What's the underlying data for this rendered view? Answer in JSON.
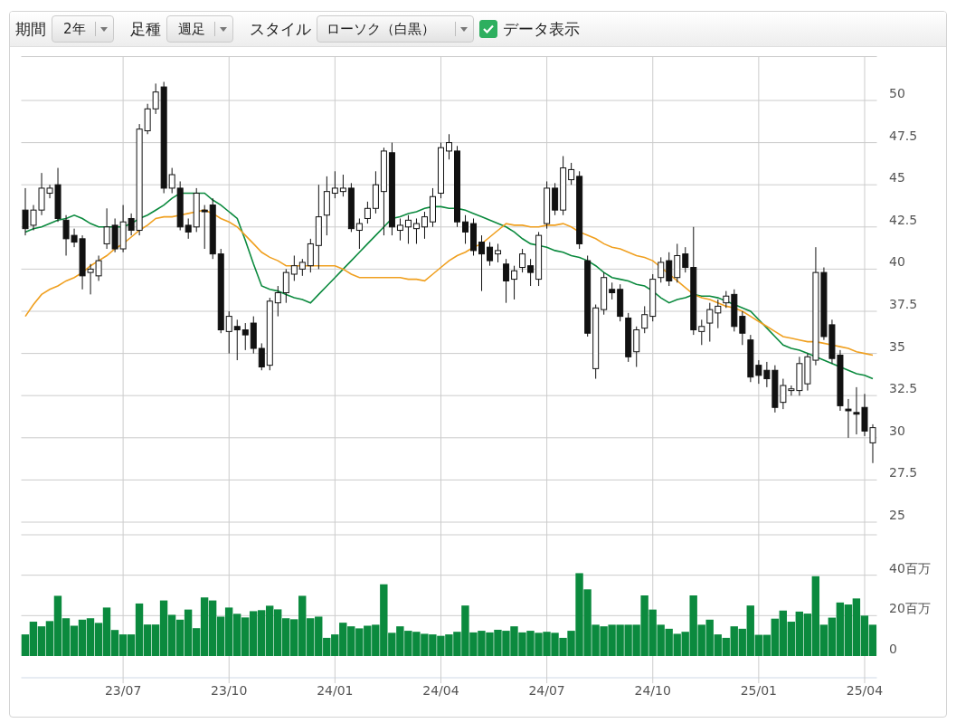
{
  "toolbar": {
    "period": {
      "label": "期間",
      "value": "2年"
    },
    "bar_type": {
      "label": "足種",
      "value": "週足"
    },
    "style": {
      "label": "スタイル",
      "value": "ローソク（白黒）"
    },
    "show_data": {
      "label": "データ表示",
      "checked": true
    }
  },
  "price_chart": {
    "chart_data": {
      "type": "candlestick",
      "grid": true,
      "ylim": [
        25,
        52.6
      ],
      "yticks": [
        25,
        27.5,
        30,
        32.5,
        35,
        37.5,
        40,
        42.5,
        45,
        47.5,
        50
      ],
      "categories": [
        null,
        null,
        null,
        null,
        null,
        null,
        null,
        null,
        null,
        null,
        null,
        null,
        null,
        null,
        null,
        null,
        null,
        null,
        null,
        null,
        null,
        null,
        null,
        null,
        null,
        null,
        null,
        null,
        null,
        null,
        null,
        null,
        null,
        null,
        null,
        null,
        null,
        null,
        null,
        null,
        null,
        null,
        null,
        null,
        null,
        null,
        null,
        null,
        null,
        null,
        null,
        null,
        null,
        null,
        null,
        null,
        null,
        null,
        null,
        null,
        null,
        null,
        null,
        null,
        null,
        null,
        null,
        null,
        null,
        null,
        null,
        null,
        null,
        null,
        null,
        null,
        null,
        null,
        null,
        null,
        null,
        null,
        null,
        null,
        null,
        null,
        null,
        null,
        null,
        null,
        null,
        null,
        null,
        null,
        null,
        null,
        null,
        null,
        null,
        null,
        null,
        null,
        null,
        null,
        null
      ],
      "ohlc": [
        [
          43.5,
          44.8,
          42.0,
          42.4
        ],
        [
          42.6,
          43.8,
          42.3,
          43.5
        ],
        [
          43.5,
          45.7,
          43.2,
          44.8
        ],
        [
          44.5,
          45.0,
          44.2,
          44.8
        ],
        [
          45.0,
          46.0,
          42.8,
          43.0
        ],
        [
          42.9,
          43.2,
          40.8,
          41.8
        ],
        [
          42.0,
          42.4,
          41.3,
          41.6
        ],
        [
          41.8,
          42.0,
          38.8,
          39.6
        ],
        [
          39.8,
          40.3,
          38.5,
          40.0
        ],
        [
          39.6,
          40.8,
          39.3,
          40.5
        ],
        [
          41.5,
          43.6,
          41.2,
          42.5
        ],
        [
          42.6,
          43.0,
          41.0,
          41.2
        ],
        [
          41.2,
          43.8,
          41.0,
          42.8
        ],
        [
          43.0,
          43.3,
          42.0,
          42.3
        ],
        [
          42.3,
          48.6,
          42.0,
          48.3
        ],
        [
          48.2,
          49.8,
          48.0,
          49.5
        ],
        [
          49.5,
          51.0,
          49.2,
          50.5
        ],
        [
          50.8,
          51.1,
          44.5,
          44.8
        ],
        [
          44.8,
          46.0,
          44.5,
          45.6
        ],
        [
          44.8,
          45.2,
          42.3,
          42.5
        ],
        [
          42.6,
          43.0,
          41.8,
          42.2
        ],
        [
          42.5,
          44.8,
          42.2,
          44.5
        ],
        [
          43.5,
          43.8,
          41.2,
          43.4
        ],
        [
          43.8,
          44.2,
          40.6,
          40.9
        ],
        [
          40.9,
          41.2,
          36.2,
          36.4
        ],
        [
          36.3,
          37.5,
          35.0,
          37.2
        ],
        [
          36.6,
          37.0,
          34.6,
          36.4
        ],
        [
          36.4,
          36.8,
          35.2,
          36.1
        ],
        [
          36.8,
          37.2,
          35.0,
          35.3
        ],
        [
          35.3,
          35.6,
          34.0,
          34.2
        ],
        [
          34.3,
          38.3,
          34.0,
          38.1
        ],
        [
          38.0,
          39.0,
          37.2,
          38.6
        ],
        [
          38.6,
          40.0,
          38.0,
          39.8
        ],
        [
          39.7,
          40.8,
          39.3,
          40.2
        ],
        [
          40.0,
          40.6,
          39.6,
          40.4
        ],
        [
          40.2,
          41.8,
          39.8,
          41.5
        ],
        [
          41.4,
          45.0,
          40.0,
          43.1
        ],
        [
          43.2,
          45.5,
          42.0,
          44.6
        ],
        [
          44.5,
          45.8,
          44.2,
          44.8
        ],
        [
          44.6,
          45.6,
          44.3,
          44.8
        ],
        [
          44.8,
          45.1,
          42.2,
          42.4
        ],
        [
          42.3,
          43.0,
          41.2,
          42.7
        ],
        [
          43.0,
          44.0,
          42.7,
          43.6
        ],
        [
          43.6,
          45.8,
          43.3,
          45.0
        ],
        [
          44.6,
          47.2,
          42.0,
          47.0
        ],
        [
          46.9,
          47.5,
          42.0,
          42.5
        ],
        [
          42.3,
          43.0,
          41.7,
          42.6
        ],
        [
          42.5,
          43.2,
          41.5,
          42.9
        ],
        [
          42.4,
          43.0,
          41.5,
          42.7
        ],
        [
          42.5,
          43.4,
          41.8,
          43.1
        ],
        [
          42.8,
          44.8,
          42.5,
          44.3
        ],
        [
          44.5,
          47.5,
          44.2,
          47.2
        ],
        [
          47.0,
          48.0,
          46.5,
          47.5
        ],
        [
          47.0,
          47.3,
          42.5,
          42.8
        ],
        [
          42.8,
          43.2,
          41.5,
          42.2
        ],
        [
          42.7,
          43.0,
          40.8,
          41.1
        ],
        [
          41.6,
          42.0,
          38.7,
          40.9
        ],
        [
          41.3,
          41.6,
          40.2,
          40.5
        ],
        [
          40.9,
          41.5,
          40.4,
          41.1
        ],
        [
          40.3,
          40.6,
          38.0,
          39.3
        ],
        [
          39.4,
          40.2,
          38.2,
          39.9
        ],
        [
          40.1,
          41.2,
          39.8,
          40.9
        ],
        [
          40.2,
          40.6,
          39.0,
          39.8
        ],
        [
          39.4,
          42.2,
          39.0,
          42.0
        ],
        [
          42.7,
          45.2,
          42.4,
          44.8
        ],
        [
          44.8,
          45.1,
          43.2,
          43.5
        ],
        [
          43.5,
          46.7,
          43.2,
          46.0
        ],
        [
          45.3,
          46.3,
          45.0,
          45.9
        ],
        [
          45.5,
          45.8,
          41.2,
          41.5
        ],
        [
          40.5,
          40.8,
          36.0,
          36.2
        ],
        [
          34.1,
          37.9,
          33.5,
          37.7
        ],
        [
          37.6,
          39.8,
          37.3,
          39.5
        ],
        [
          38.8,
          39.2,
          38.2,
          38.6
        ],
        [
          38.8,
          39.1,
          36.9,
          37.2
        ],
        [
          37.1,
          37.4,
          34.5,
          34.8
        ],
        [
          35.1,
          36.6,
          34.2,
          36.4
        ],
        [
          36.5,
          37.8,
          36.2,
          37.3
        ],
        [
          37.2,
          39.7,
          36.9,
          39.4
        ],
        [
          39.5,
          40.7,
          39.2,
          40.4
        ],
        [
          40.5,
          41.0,
          39.0,
          39.3
        ],
        [
          39.5,
          41.5,
          39.2,
          40.8
        ],
        [
          40.9,
          41.3,
          39.8,
          40.1
        ],
        [
          40.1,
          42.5,
          36.1,
          36.4
        ],
        [
          36.3,
          37.0,
          35.5,
          36.6
        ],
        [
          36.8,
          38.0,
          35.7,
          37.6
        ],
        [
          37.4,
          38.2,
          36.5,
          37.8
        ],
        [
          38.0,
          38.7,
          37.7,
          38.4
        ],
        [
          38.5,
          38.8,
          36.3,
          36.6
        ],
        [
          37.2,
          37.5,
          35.5,
          36.2
        ],
        [
          35.8,
          36.1,
          33.3,
          33.6
        ],
        [
          34.3,
          34.6,
          33.2,
          33.7
        ],
        [
          34.0,
          34.5,
          33.0,
          33.5
        ],
        [
          34.0,
          34.3,
          31.5,
          31.8
        ],
        [
          32.1,
          33.5,
          31.7,
          33.1
        ],
        [
          32.8,
          33.1,
          32.5,
          32.9
        ],
        [
          32.8,
          34.8,
          32.5,
          34.4
        ],
        [
          33.2,
          35.0,
          32.8,
          34.8
        ],
        [
          34.6,
          41.3,
          34.3,
          39.8
        ],
        [
          39.8,
          40.1,
          35.8,
          36.0
        ],
        [
          36.7,
          37.0,
          34.4,
          34.7
        ],
        [
          34.9,
          35.2,
          31.6,
          31.9
        ],
        [
          31.7,
          32.3,
          30.0,
          31.6
        ],
        [
          31.5,
          33.0,
          30.2,
          31.4
        ],
        [
          31.8,
          32.6,
          30.1,
          30.4
        ],
        [
          29.7,
          30.8,
          28.5,
          30.6
        ]
      ],
      "series": [
        {
          "type": "line",
          "color": "#0b8a3e",
          "values": [
            42.2,
            42.4,
            42.5,
            42.7,
            42.9,
            43.0,
            43.2,
            43.0,
            42.7,
            42.5,
            42.5,
            42.5,
            42.5,
            42.7,
            43.0,
            43.2,
            43.5,
            43.8,
            44.2,
            44.5,
            44.5,
            44.5,
            44.5,
            44.1,
            43.8,
            43.4,
            43.0,
            41.7,
            40.3,
            39.0,
            38.8,
            38.7,
            38.5,
            38.3,
            38.2,
            38.0,
            38.5,
            39.0,
            39.5,
            40.0,
            40.5,
            41.0,
            41.5,
            42.0,
            42.5,
            43.0,
            43.1,
            43.3,
            43.4,
            43.6,
            43.7,
            43.7,
            43.6,
            43.6,
            43.5,
            43.3,
            43.1,
            42.9,
            42.7,
            42.5,
            42.2,
            41.8,
            41.5,
            41.4,
            41.3,
            41.1,
            41.0,
            40.8,
            40.7,
            40.5,
            40.2,
            39.8,
            39.5,
            39.4,
            39.3,
            39.1,
            39.0,
            38.7,
            38.3,
            38.0,
            38.2,
            38.3,
            38.5,
            38.4,
            38.4,
            38.3,
            38.1,
            37.9,
            37.7,
            37.5,
            37.0,
            36.5,
            36.0,
            35.5,
            35.3,
            35.2,
            35.0,
            34.8,
            34.6,
            34.4,
            34.2,
            34.0,
            33.8,
            33.7,
            33.5
          ]
        },
        {
          "type": "line",
          "color": "#f0a020",
          "values": [
            37.2,
            37.9,
            38.5,
            38.8,
            39.0,
            39.3,
            39.5,
            39.8,
            40.2,
            40.5,
            40.8,
            41.2,
            41.5,
            41.9,
            42.3,
            42.6,
            43.0,
            43.1,
            43.1,
            43.2,
            43.3,
            43.4,
            43.5,
            43.3,
            43.0,
            42.8,
            42.5,
            42.0,
            41.5,
            41.0,
            40.7,
            40.5,
            40.2,
            40.2,
            40.2,
            40.2,
            40.2,
            40.2,
            40.2,
            40.0,
            39.7,
            39.5,
            39.5,
            39.5,
            39.5,
            39.5,
            39.5,
            39.4,
            39.4,
            39.3,
            39.7,
            40.1,
            40.5,
            40.8,
            41.0,
            41.3,
            41.5,
            41.9,
            42.3,
            42.7,
            42.6,
            42.6,
            42.5,
            42.5,
            42.6,
            42.6,
            42.7,
            42.5,
            42.2,
            42.0,
            41.8,
            41.5,
            41.3,
            41.2,
            41.0,
            40.8,
            40.7,
            40.5,
            40.1,
            39.7,
            39.3,
            38.9,
            38.5,
            38.3,
            38.2,
            38.0,
            37.8,
            37.7,
            37.5,
            37.2,
            36.9,
            36.6,
            36.3,
            36.0,
            35.9,
            35.8,
            35.7,
            35.7,
            35.6,
            35.5,
            35.4,
            35.3,
            35.1,
            35.0,
            34.9
          ]
        }
      ]
    }
  },
  "volume_chart": {
    "chart_data": {
      "type": "bar",
      "grid": true,
      "ylim": [
        0,
        60
      ],
      "yticks": [
        {
          "value": 0,
          "label": "0"
        },
        {
          "value": 20,
          "label": "20百万"
        },
        {
          "value": 40,
          "label": "40百万"
        }
      ],
      "categories": [
        null,
        null,
        null,
        null,
        null,
        null,
        null,
        null,
        null,
        null,
        null,
        null,
        "23/07",
        null,
        null,
        null,
        null,
        null,
        null,
        null,
        null,
        null,
        null,
        null,
        null,
        "23/10",
        null,
        null,
        null,
        null,
        null,
        null,
        null,
        null,
        null,
        null,
        null,
        null,
        "24/01",
        null,
        null,
        null,
        null,
        null,
        null,
        null,
        null,
        null,
        null,
        null,
        null,
        "24/04",
        null,
        null,
        null,
        null,
        null,
        null,
        null,
        null,
        null,
        null,
        null,
        null,
        "24/07",
        null,
        null,
        null,
        null,
        null,
        null,
        null,
        null,
        null,
        null,
        null,
        null,
        "24/10",
        null,
        null,
        null,
        null,
        null,
        null,
        null,
        null,
        null,
        null,
        null,
        null,
        "25/01",
        null,
        null,
        null,
        null,
        null,
        null,
        null,
        null,
        null,
        null,
        null,
        null,
        "25/04",
        null
      ],
      "series": [
        {
          "color": "#0b8a3e",
          "values": [
            10.7,
            17,
            14.7,
            17.3,
            29.8,
            18.7,
            15,
            18,
            18.7,
            16.4,
            24,
            12.9,
            10.7,
            10.7,
            26,
            15.6,
            15.6,
            27.5,
            20.4,
            18,
            23,
            13.8,
            29,
            27.5,
            19.5,
            24,
            20.9,
            19.1,
            22.2,
            22.7,
            24.9,
            23.1,
            18.7,
            18.2,
            29.8,
            18.7,
            19.5,
            9,
            10.7,
            16.5,
            14.7,
            13.7,
            15,
            15.5,
            35.5,
            11.5,
            14.7,
            12.5,
            12,
            11,
            10.7,
            10,
            10.7,
            12,
            25,
            11.7,
            12.5,
            11.7,
            13,
            12.5,
            14.7,
            11.7,
            12.5,
            11.5,
            12,
            11.5,
            9,
            12.5,
            41,
            33,
            15.5,
            14.7,
            15.5,
            15.5,
            15.5,
            15.5,
            30,
            23,
            15.5,
            13.5,
            11,
            12,
            30,
            15.5,
            18,
            10.7,
            9,
            14.7,
            13.5,
            25,
            10.5,
            10.5,
            18.5,
            22.5,
            17,
            22,
            21,
            39.5,
            15.5,
            19,
            26.5,
            25.5,
            28.5,
            20,
            15.5
          ]
        }
      ]
    }
  }
}
